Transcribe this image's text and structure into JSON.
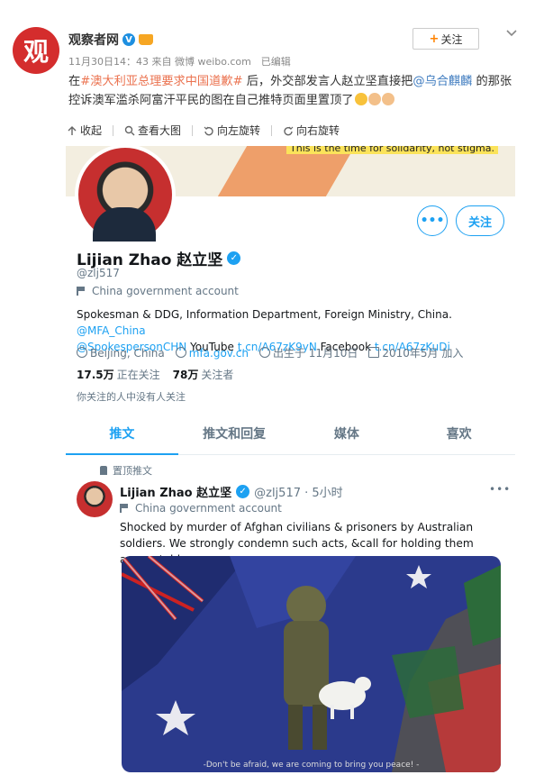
{
  "weibo": {
    "avatar_char": "观",
    "name": "观察者网",
    "meta": "11月30日14：43 来自 微博 weibo.com　已编辑",
    "follow_label": "关注",
    "text": {
      "t1": "在",
      "hashtag": "#澳大利亚总理要求中国道歉#",
      "t2": " 后，外交部发言人赵立坚直接把",
      "mention": "@乌合麒麟",
      "t3": " 的那张控诉澳军滥杀阿富汗平民的图在自己推特页面里置顶了"
    },
    "toolbar": {
      "collapse": "收起",
      "view_large": "查看大图",
      "rotate_left": "向左旋转",
      "rotate_right": "向右旋转"
    }
  },
  "twitter": {
    "banner_text": "This is the time for solidarity, not stigma.",
    "more_label": "•••",
    "follow_label": "关注",
    "name": "Lijian Zhao 赵立坚",
    "handle": "@zlj517",
    "gov_label": "China government account",
    "bio": {
      "b1": "Spokesman & DDG, Information Department, Foreign Ministry, China. ",
      "b2": "@MFA_China",
      "b3": "@SpokespersonCHN",
      "b4": " YouTube ",
      "b5": "t.cn/A67zK9yN",
      "b6": " Facebook ",
      "b7": "t.cn/A67zKuDi"
    },
    "location": "Beijing, China",
    "website": "mfa.gov.cn",
    "birthday": "出生于 11月10日",
    "joined": "2010年5月 加入",
    "following_count": "17.5万",
    "following_label": "正在关注",
    "followers_count": "78万",
    "followers_label": "关注者",
    "no_mutual": "你关注的人中没有人关注",
    "tabs": [
      "推文",
      "推文和回复",
      "媒体",
      "喜欢"
    ],
    "pinned_label": "置顶推文",
    "tweet": {
      "name": "Lijian Zhao 赵立坚",
      "handle_time": "@zlj517 · 5小时",
      "gov_label": "China government account",
      "text": "Shocked by murder of Afghan civilians & prisoners by Australian soldiers. We strongly condemn such acts, &call for holding them accountable.",
      "image_caption": "-Don't be afraid,  we are coming to bring you peace! -"
    }
  },
  "colors": {
    "weibo_link": "#eb7350",
    "weibo_blue": "#3e7bbf",
    "twitter_blue": "#1da1f2"
  }
}
